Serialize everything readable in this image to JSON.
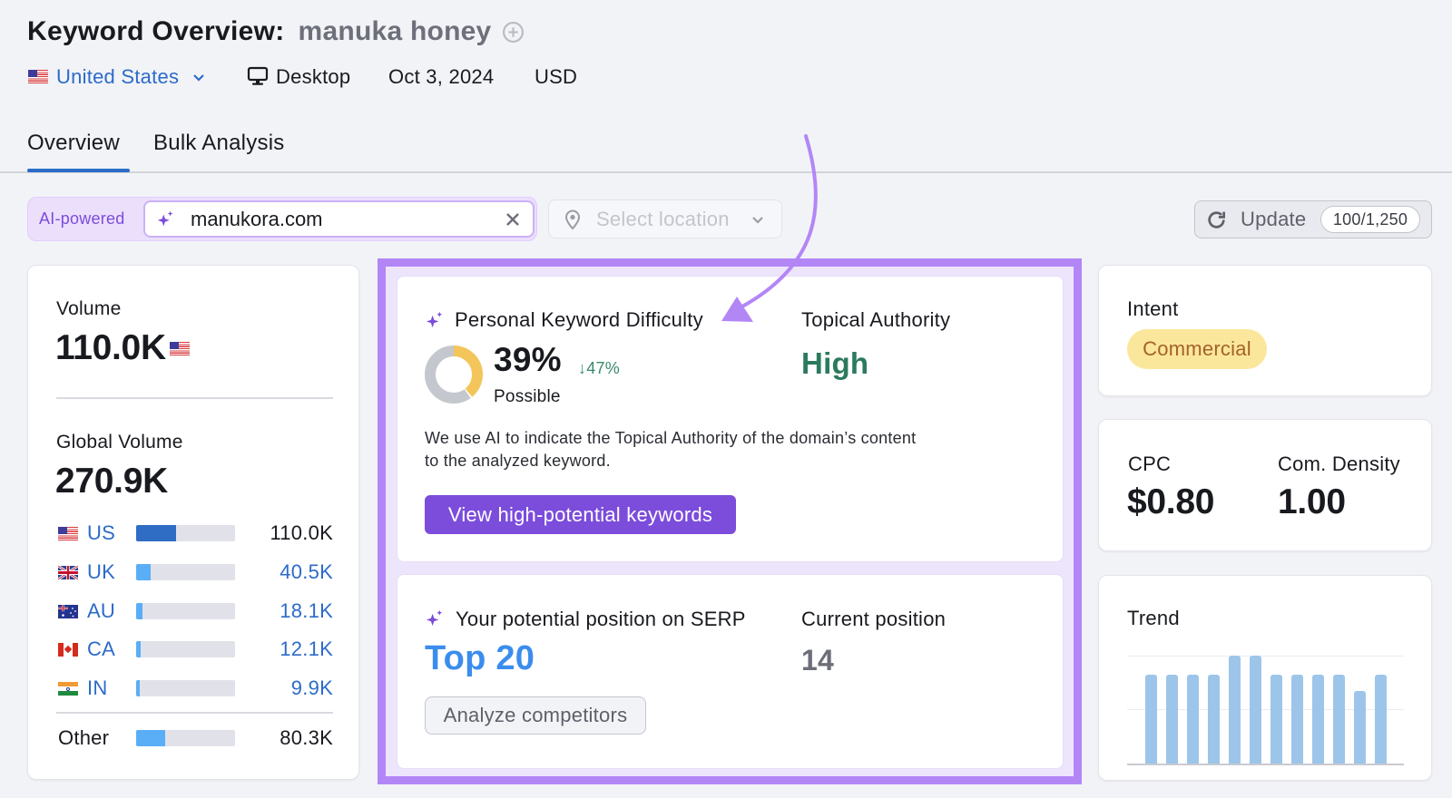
{
  "header": {
    "title": "Keyword Overview:",
    "keyword": "manuka honey",
    "database": "United States",
    "device": "Desktop",
    "date": "Oct 3, 2024",
    "currency": "USD"
  },
  "tabs": [
    {
      "label": "Overview",
      "active": true
    },
    {
      "label": "Bulk Analysis",
      "active": false
    }
  ],
  "toolbar": {
    "ai_badge": "AI-powered",
    "domain_input_value": "manukora.com",
    "location_placeholder": "Select location",
    "update_label": "Update",
    "update_counter": "100/1,250"
  },
  "volume_card": {
    "volume_label": "Volume",
    "volume_value": "110.0K",
    "global_label": "Global Volume",
    "global_value": "270.9K",
    "countries": [
      {
        "code": "US",
        "flag": "us-flag-icon",
        "value": "110.0K",
        "share": 0.406
      },
      {
        "code": "UK",
        "flag": "uk-flag-icon",
        "value": "40.5K",
        "share": 0.15
      },
      {
        "code": "AU",
        "flag": "au-flag-icon",
        "value": "18.1K",
        "share": 0.067
      },
      {
        "code": "CA",
        "flag": "ca-flag-icon",
        "value": "12.1K",
        "share": 0.045
      },
      {
        "code": "IN",
        "flag": "in-flag-icon",
        "value": "9.9K",
        "share": 0.037
      }
    ],
    "other": {
      "label": "Other",
      "value": "80.3K",
      "share": 0.296
    }
  },
  "pkd_card": {
    "title": "Personal Keyword Difficulty",
    "value": "39%",
    "percent": 39,
    "delta": "↓47%",
    "level": "Possible",
    "topical_authority_label": "Topical Authority",
    "topical_authority_value": "High",
    "description_lines": [
      "We use AI to indicate the Topical Authority of the domain’s content",
      "to the analyzed keyword."
    ],
    "cta_label": "View high-potential keywords"
  },
  "serp_card": {
    "potential_label": "Your potential position on SERP",
    "potential_value": "Top 20",
    "current_label": "Current position",
    "current_value": "14",
    "cta_label": "Analyze competitors"
  },
  "intent_card": {
    "label": "Intent",
    "value": "Commercial"
  },
  "cpc_card": {
    "cpc_label": "CPC",
    "cpc_value": "$0.80",
    "density_label": "Com. Density",
    "density_value": "1.00"
  },
  "trend_card": {
    "label": "Trend",
    "relative_values": [
      82,
      82,
      82,
      82,
      100,
      100,
      82,
      82,
      82,
      82,
      67,
      82
    ]
  },
  "colors": {
    "accent-purple": "#7c4cdb",
    "annotation-purple": "#b386f6",
    "link-blue": "#2c6bc9",
    "tab-underline": "#2a6cc6",
    "bar-dark-blue": "#2f6cc4",
    "bar-light-blue": "#5aaef7",
    "authority-green": "#2b7a5d",
    "delta-green": "#3a8a6a",
    "position-blue": "#3b8ded",
    "intent-bg": "#fbe79b",
    "intent-text": "#a3622a",
    "donut-yellow": "#f3c55a",
    "donut-gray": "#c5c7ce",
    "trend-bar": "#9dc5ea",
    "keyword-gray": "#6d6f7a"
  }
}
